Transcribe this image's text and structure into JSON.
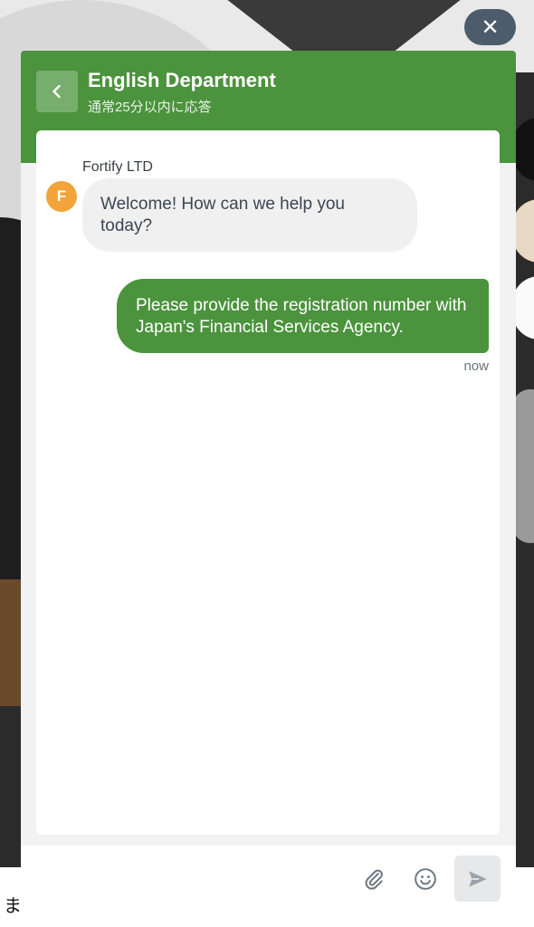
{
  "colors": {
    "brand": "#4b933d",
    "header_bg": "#4b933d",
    "avatar": "#f2a33a",
    "close_button": "#4d5c6b"
  },
  "close_button": {
    "icon": "close-icon",
    "label": "✕"
  },
  "header": {
    "back_icon": "chevron-left-icon",
    "title": "English Department",
    "subtitle": "通常25分以内に応答"
  },
  "conversation": {
    "agent_name": "Fortify LTD",
    "avatar_initial": "F",
    "incoming_message": "Welcome! How can we help you today?",
    "outgoing_message": "Please provide the registration number with Japan's Financial Services Agency.",
    "outgoing_timestamp": "now"
  },
  "composer": {
    "attach_icon": "paperclip-icon",
    "emoji_icon": "smiley-icon",
    "send_icon": "send-icon"
  },
  "background": {
    "partial_char": "ま"
  }
}
